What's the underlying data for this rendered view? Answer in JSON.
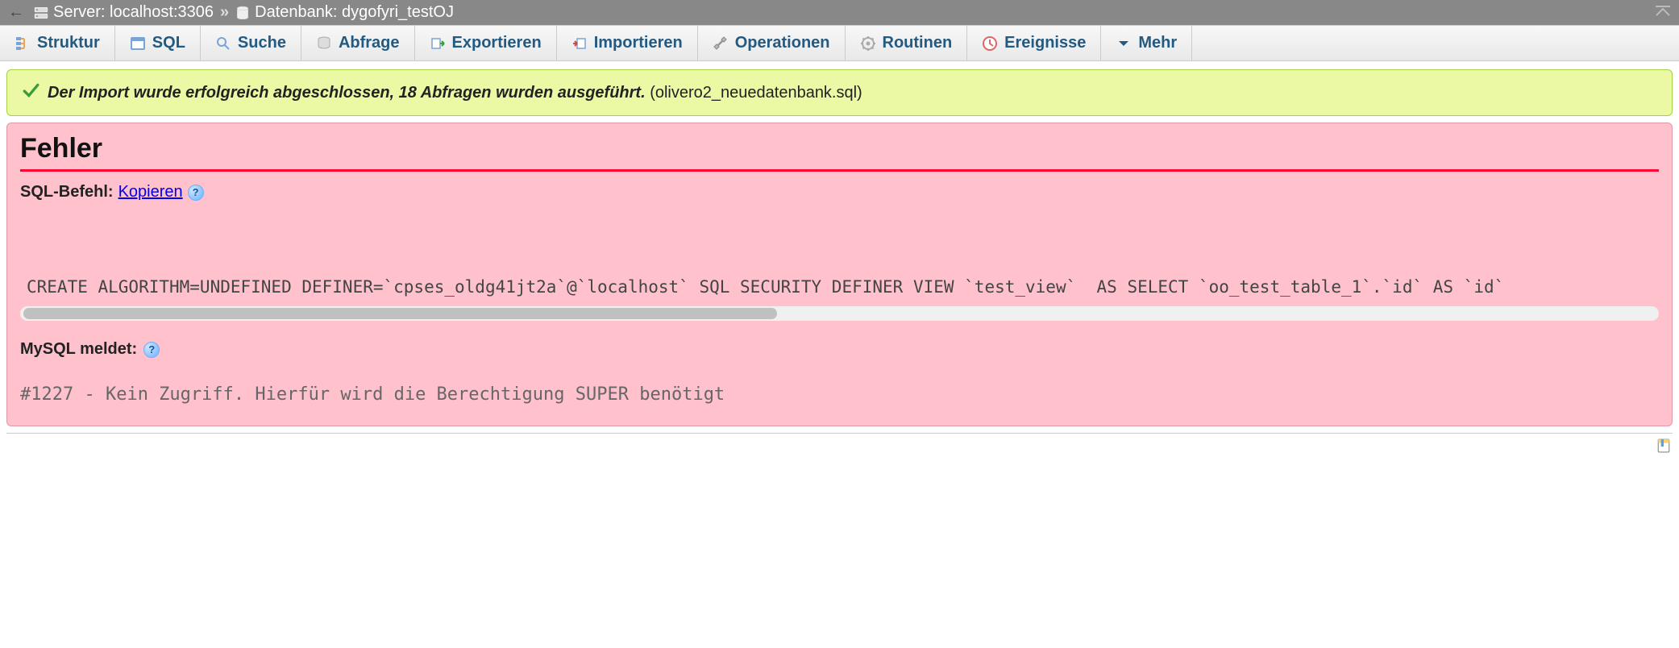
{
  "breadcrumb": {
    "server_label": "Server: localhost:3306",
    "db_label": "Datenbank: dygofyri_testOJ"
  },
  "tabs": {
    "struktur": "Struktur",
    "sql": "SQL",
    "suche": "Suche",
    "abfrage": "Abfrage",
    "exportieren": "Exportieren",
    "importieren": "Importieren",
    "operationen": "Operationen",
    "routinen": "Routinen",
    "ereignisse": "Ereignisse",
    "mehr": "Mehr"
  },
  "success": {
    "message_italic": "Der Import wurde erfolgreich abgeschlossen, 18 Abfragen wurden ausgeführt.",
    "filename": "(olivero2_neuedatenbank.sql)"
  },
  "error": {
    "title": "Fehler",
    "sql_befehl_label": "SQL-Befehl:",
    "kopieren": "Kopieren",
    "code": "CREATE ALGORITHM=UNDEFINED DEFINER=`cpses_oldg41jt2a`@`localhost` SQL SECURITY DEFINER VIEW `test_view`  AS SELECT `oo_test_table_1`.`id` AS `id`",
    "mysql_meldet": "MySQL meldet:",
    "mysql_message": "#1227 - Kein Zugriff. Hierfür wird die Berechtigung SUPER benötigt"
  }
}
